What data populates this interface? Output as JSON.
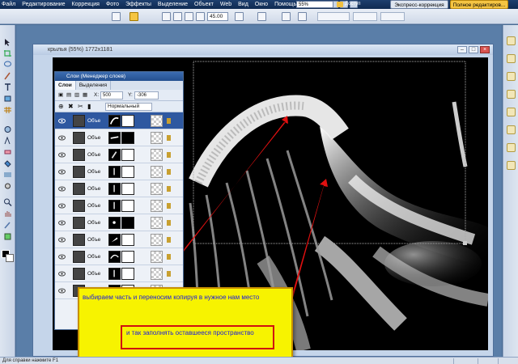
{
  "menubar": {
    "items": [
      "Файл",
      "Редактирование",
      "Коррекция",
      "Фото",
      "Эффекты",
      "Выделение",
      "Объект",
      "Web",
      "Вид",
      "Окно",
      "Помощь"
    ],
    "zoom_value": "55%",
    "access_label": "Доступ",
    "express_label": "Экспресс-коррекция",
    "full_edit_label": "Полное редактиров..."
  },
  "options": {
    "angle_value": "45.00"
  },
  "document": {
    "title": "крылья (55%) 1772x1181"
  },
  "layers_panel": {
    "title": "Слои (Менеджер слоев)",
    "tabs": [
      "Слои",
      "Выделения"
    ],
    "x_label": "X:",
    "x_value": "500",
    "y_label": "Y:",
    "y_value": "-306",
    "blend_mode": "Нормальный",
    "layers": [
      {
        "name": "Объе",
        "selected": true
      },
      {
        "name": "Объе",
        "selected": false
      },
      {
        "name": "Объе",
        "selected": false
      },
      {
        "name": "Объе",
        "selected": false
      },
      {
        "name": "Объе",
        "selected": false
      },
      {
        "name": "Объе",
        "selected": false
      },
      {
        "name": "Объе",
        "selected": false
      },
      {
        "name": "Объе",
        "selected": false
      },
      {
        "name": "Объе",
        "selected": false
      },
      {
        "name": "Объе",
        "selected": false
      },
      {
        "name": "Объе",
        "selected": false
      }
    ]
  },
  "annotations": {
    "main_text": "выбираем часть и переносим копируя в нужное нам место",
    "secondary_text": "и так заполнять оставшееся пространство",
    "text_color": "#1a1ae0",
    "box_color": "#f7f300",
    "arrow_color": "#e01010"
  },
  "statusbar": {
    "text": "Для справки нажмите F1"
  }
}
